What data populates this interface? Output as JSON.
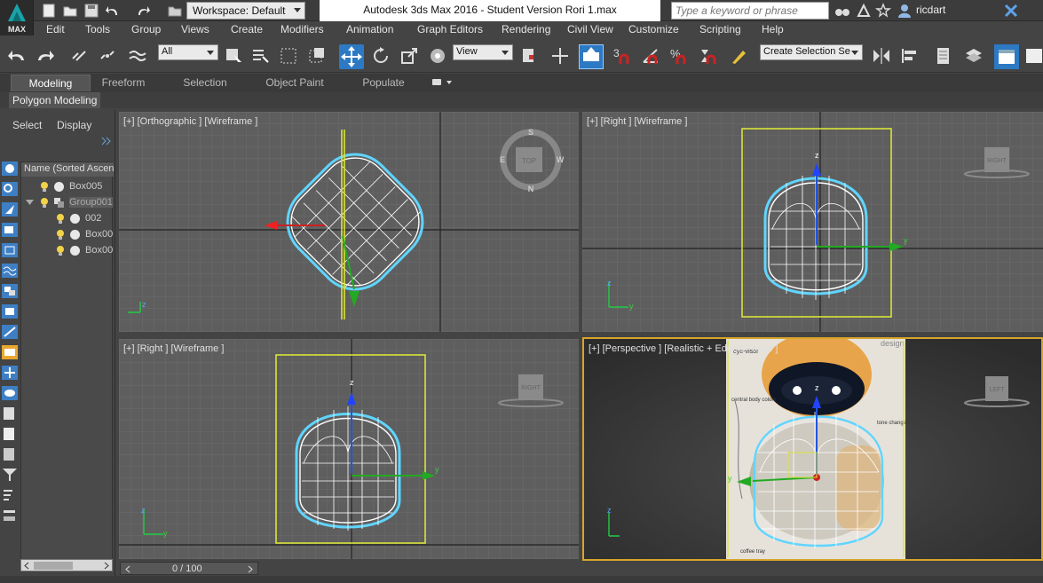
{
  "app": {
    "logo_label": "MAX",
    "workspace": "Workspace: Default",
    "title": "Autodesk 3ds Max 2016 - Student Version    Rori 1.max",
    "search_placeholder": "Type a keyword or phrase",
    "user": "ricdart"
  },
  "menu": [
    "Edit",
    "Tools",
    "Group",
    "Views",
    "Create",
    "Modifiers",
    "Animation",
    "Graph Editors",
    "Rendering",
    "Civil View",
    "Customize",
    "Scripting",
    "Help"
  ],
  "toolbar": {
    "selection_filter": "All",
    "reference_coord": "View",
    "selection_set_placeholder": "Create Selection Se",
    "snap_label": "3",
    "percent_label": "%"
  },
  "ribbon": {
    "tabs": [
      "Modeling",
      "Freeform",
      "Selection",
      "Object Paint",
      "Populate"
    ],
    "active_tab": "Modeling",
    "panel_label": "Polygon Modeling"
  },
  "explorer": {
    "tabs": [
      "Select",
      "Display"
    ],
    "column_header": "Name (Sorted Ascending)",
    "items": [
      {
        "name": "Box005",
        "level": 0
      },
      {
        "name": "Group001",
        "level": 0
      },
      {
        "name": "002",
        "level": 1
      },
      {
        "name": "Box00",
        "level": 1
      },
      {
        "name": "Box00",
        "level": 1
      }
    ]
  },
  "viewports": {
    "top_left": {
      "label": "[+] [Orthographic ] [Wireframe ]",
      "compass": {
        "s": "S",
        "w": "W",
        "n": "N",
        "e": "E",
        "cube": "TOP"
      }
    },
    "top_right": {
      "label": "[+] [Right ] [Wireframe ]",
      "cube": "RIGHT"
    },
    "bottom_left": {
      "label": "[+] [Right ] [Wireframe ]",
      "cube": "RIGHT"
    },
    "bottom_right": {
      "label": "[+] [Perspective ] [Realistic + Edged Faces ]",
      "cube": "LEFT"
    }
  },
  "reference_notes": {
    "top": "eye-visor",
    "middle": "central body colors",
    "side": "tone changes",
    "bottom": "coffee tray",
    "corner": "design"
  },
  "axes": {
    "x": "x",
    "y": "y",
    "z": "z"
  },
  "timeline": {
    "frame": "0 / 100"
  }
}
